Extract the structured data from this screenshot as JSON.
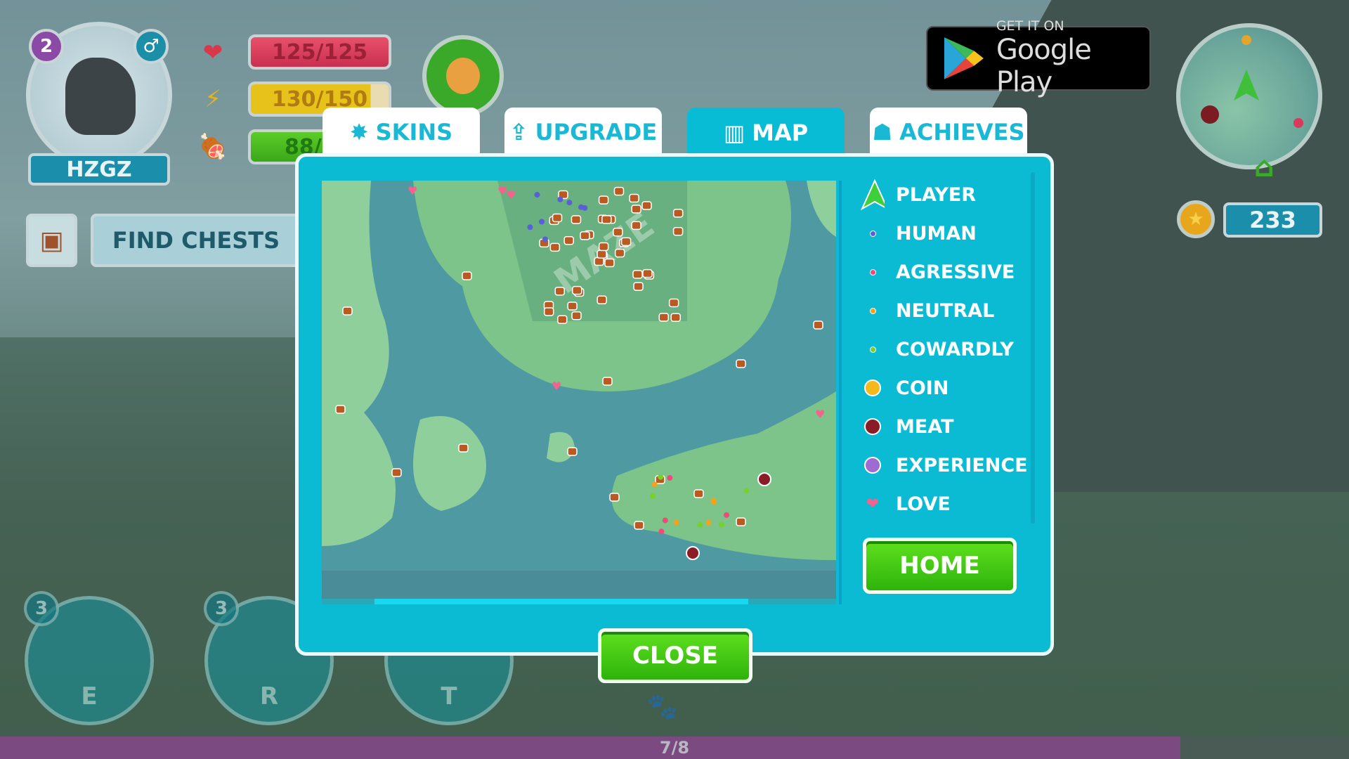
{
  "hud": {
    "level": "2",
    "gender_icon": "male-symbol-icon",
    "player_name": "HZGZ",
    "health": "125/125",
    "energy": "130/150",
    "energy_fraction": 0.867,
    "hunger": "88/",
    "find_chests_label": "FIND CHESTS",
    "coins": "233",
    "google_play": {
      "line1": "GET IT ON",
      "line2": "Google Play"
    }
  },
  "tabs": [
    {
      "label": "SKINS",
      "icon": "leather-icon"
    },
    {
      "label": "UPGRADE",
      "icon": "upgrade-arrow-icon"
    },
    {
      "label": "MAP",
      "icon": "map-icon",
      "active": true
    },
    {
      "label": "ACHIEVES",
      "icon": "medal-icon"
    }
  ],
  "map": {
    "watermark": "MAZE"
  },
  "legend": [
    {
      "label": "PLAYER",
      "color": "#3fcf3a"
    },
    {
      "label": "HUMAN",
      "color": "#5a5fd8"
    },
    {
      "label": "AGRESSIVE",
      "color": "#ee4a7a"
    },
    {
      "label": "NEUTRAL",
      "color": "#f2a31e"
    },
    {
      "label": "COWARDLY",
      "color": "#76d12a"
    },
    {
      "label": "COIN",
      "color": "#f5b91c"
    },
    {
      "label": "MEAT",
      "color": "#8a1c25"
    },
    {
      "label": "EXPERIENCE",
      "color": "#a06bd0"
    },
    {
      "label": "LOVE",
      "color": "#f2648e"
    }
  ],
  "buttons": {
    "home": "HOME",
    "close": "CLOSE"
  },
  "abilities": [
    {
      "key": "E",
      "count": "3",
      "icon": "lightning-icon"
    },
    {
      "key": "R",
      "count": "3",
      "icon": "heart-plus-icon"
    },
    {
      "key": "T",
      "count": "",
      "icon": "meat-icon"
    }
  ],
  "progress": {
    "label": "7/8",
    "fraction": 0.875
  }
}
